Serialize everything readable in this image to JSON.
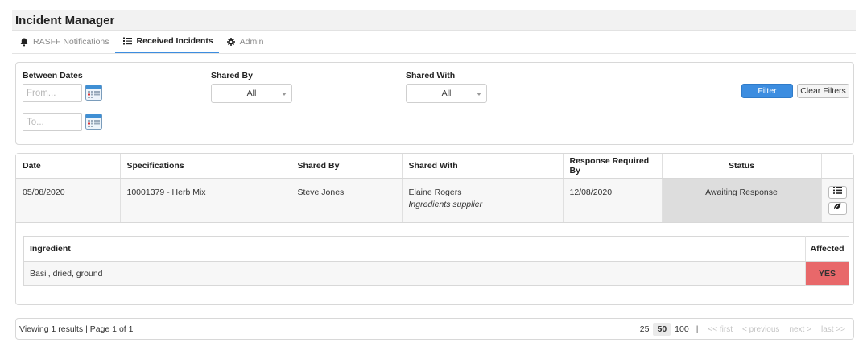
{
  "app": {
    "title": "Incident Manager"
  },
  "tabs": [
    {
      "label": "RASFF Notifications",
      "icon": "bell-icon",
      "active": false
    },
    {
      "label": "Received Incidents",
      "icon": "list-icon",
      "active": true
    },
    {
      "label": "Admin",
      "icon": "gear-icon",
      "active": false
    }
  ],
  "filters": {
    "between_dates_label": "Between Dates",
    "from_placeholder": "From...",
    "to_placeholder": "To...",
    "shared_by_label": "Shared By",
    "shared_by_value": "All",
    "shared_with_label": "Shared With",
    "shared_with_value": "All",
    "filter_button": "Filter",
    "clear_button": "Clear Filters",
    "colors": {
      "primary": "#3c8de0"
    }
  },
  "table": {
    "columns": [
      "Date",
      "Specifications",
      "Shared By",
      "Shared With",
      "Response Required By",
      "Status"
    ],
    "rows": [
      {
        "date": "05/08/2020",
        "specification": "10001379 - Herb Mix",
        "shared_by": "Steve Jones",
        "shared_with": "Elaine Rogers",
        "shared_with_role": "Ingredients supplier",
        "response_required_by": "12/08/2020",
        "status": "Awaiting Response",
        "actions": [
          "list-icon",
          "leaf-icon"
        ]
      }
    ]
  },
  "ingredients": {
    "columns": [
      "Ingredient",
      "Affected"
    ],
    "rows": [
      {
        "ingredient": "Basil, dried, ground",
        "affected": "YES",
        "affected_color": "#e8686a"
      }
    ]
  },
  "footer": {
    "summary": "Viewing 1 results | Page 1 of 1",
    "page_sizes": [
      "25",
      "50",
      "100"
    ],
    "active_page_size": "50",
    "separator": "|",
    "nav": {
      "first": "<< first",
      "previous": "< previous",
      "next": "next >",
      "last": "last >>"
    }
  }
}
